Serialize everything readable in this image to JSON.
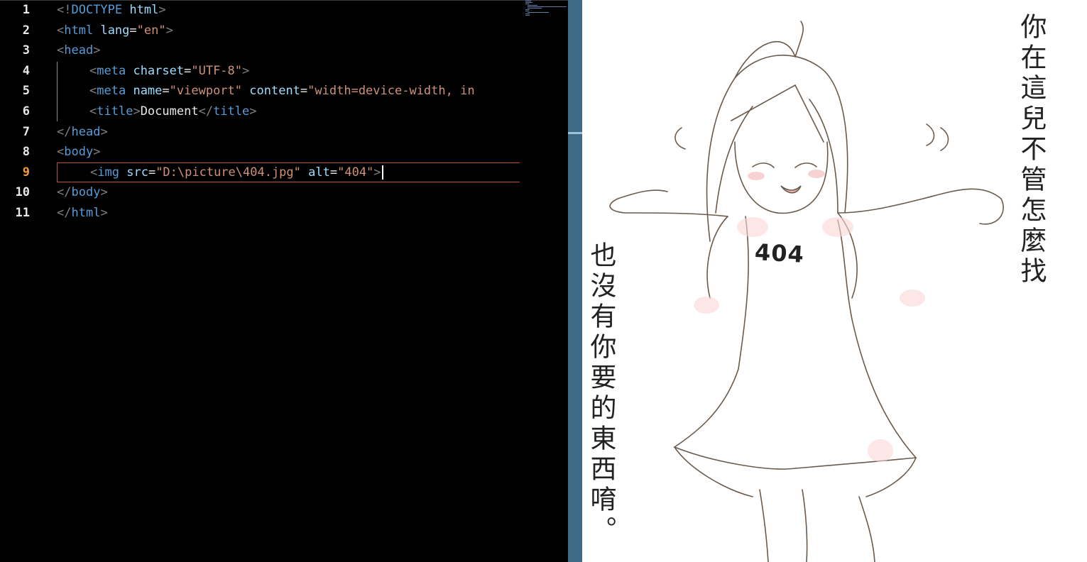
{
  "editor": {
    "line_numbers": [
      "1",
      "2",
      "3",
      "4",
      "5",
      "6",
      "7",
      "8",
      "9",
      "10",
      "11"
    ],
    "active_line": "9",
    "lines": {
      "l1": {
        "open": "<!",
        "tag": "DOCTYPE",
        "attr": "html",
        "close": ">"
      },
      "l2": {
        "open": "<",
        "tag": "html",
        "attr": "lang",
        "eq": "=",
        "val": "\"en\"",
        "close": ">"
      },
      "l3": {
        "open": "<",
        "tag": "head",
        "close": ">"
      },
      "l4": {
        "open": "<",
        "tag": "meta",
        "attr": "charset",
        "eq": "=",
        "val": "\"UTF-8\"",
        "close": ">"
      },
      "l5": {
        "open": "<",
        "tag": "meta",
        "attr1": "name",
        "eq": "=",
        "val1": "\"viewport\"",
        "attr2": "content",
        "val2": "\"width=device-width, in"
      },
      "l6": {
        "open": "<",
        "tag": "title",
        "close": ">",
        "text": "Document",
        "open2": "</",
        "tag2": "title",
        "close2": ">"
      },
      "l7": {
        "open": "</",
        "tag": "head",
        "close": ">"
      },
      "l8": {
        "open": "<",
        "tag": "body",
        "close": ">"
      },
      "l9": {
        "open": "<",
        "tag": "img",
        "attr1": "src",
        "eq": "=",
        "val1": "\"D:\\picture\\404.jpg\"",
        "attr2": "alt",
        "val2": "\"404\"",
        "close": ">"
      },
      "l10": {
        "open": "</",
        "tag": "body",
        "close": ">"
      },
      "l11": {
        "open": "</",
        "tag": "html",
        "close": ">"
      }
    }
  },
  "preview": {
    "image_alt": "404",
    "badge_text": "404",
    "caption_right": "你在這兒不管怎麼找",
    "caption_left": "也沒有你要的東西唷。"
  },
  "colors": {
    "tag": "#569cd6",
    "attribute": "#9cdcfe",
    "string": "#ce9178",
    "bracket": "#808080",
    "active_line_number": "#f29c38",
    "scrollbar": "#3f6a86"
  }
}
